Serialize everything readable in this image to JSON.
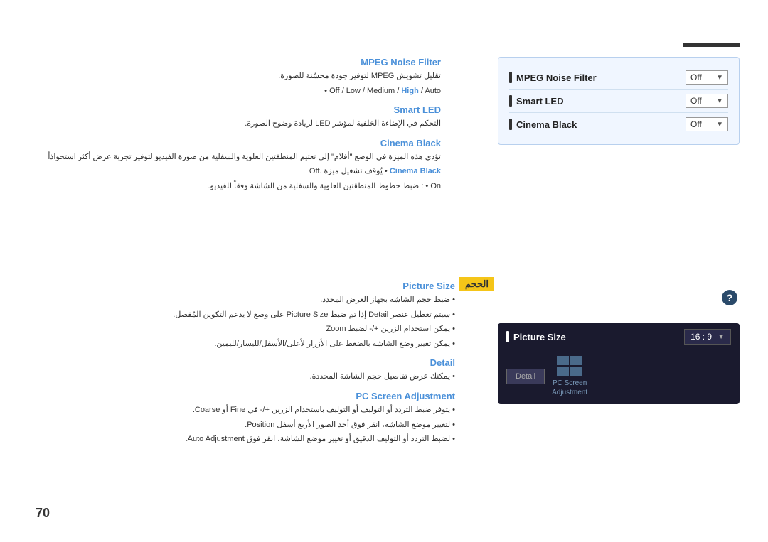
{
  "page": {
    "number": "70"
  },
  "top_section": {
    "mpeg_noise_filter": {
      "heading": "MPEG Noise Filter",
      "arabic_desc": "تقليل تشويش MPEG لتوفير جودة محسّنة للصورة.",
      "options_label": "Off / Low / Medium / High / Auto",
      "options_highlight": "High"
    },
    "smart_led": {
      "heading": "Smart LED",
      "arabic_desc": "التحكم في الإضاءة الخلفية لمؤشر LED لزيادة وضوح الصورة."
    },
    "cinema_black": {
      "heading": "Cinema Black",
      "arabic_intro": "تؤدي هذه الميزة في الوضع \"أفلام\" إلى تعتيم المنطقتين العلوية والسفلية من صورة الفيديو لتوفير تجربة عرض أكثر استحواذاً",
      "off_desc": "Off • يُوقف تشغيل ميزة Cinema Black.",
      "on_desc": "On : ضبط خطوط المنطقتين العلوية والسفلية من الشاشة وفقاً للفيديو."
    }
  },
  "control_panel": {
    "items": [
      {
        "label": "MPEG Noise Filter",
        "value": "Off",
        "bar": true
      },
      {
        "label": "Smart LED",
        "value": "Off",
        "bar": true
      },
      {
        "label": "Cinema Black",
        "value": "Off",
        "bar": true
      }
    ]
  },
  "bottom_section": {
    "yellow_label": "الحجم",
    "picture_size": {
      "heading": "Picture Size",
      "desc1": "• ضبط حجم الشاشة بجهاز العرض المحدد.",
      "desc2": "• سيتم تعطيل عنصر Detail إذا تم ضبط Picture Size على وضع لا يدعم التكوين المُفصل.",
      "desc3": "• يمكن استخدام الزرين +/- لضبط Zoom",
      "desc4": "• يمكن تغيير وضع الشاشة بالضغط على الأزرار لأعلى/الأسفل/لليسار/لليمين."
    },
    "detail": {
      "heading": "Detail",
      "desc": "• يمكنك عرض تفاصيل حجم الشاشة المحددة."
    },
    "pc_screen": {
      "heading": "PC Screen Adjustment",
      "desc1": "• يتوفر ضبط التردد أو التوليف أو التوليف باستخدام الزرين +/- في Fine أو Coarse.",
      "desc2": "• لتغيير موضع الشاشة، انقر فوق أحد الصور الأربع أسفل Position.",
      "desc3": "• لضبط التردد أو التوليف الدقيق أو تغيير موضع الشاشة، انقر فوق Auto Adjustment."
    },
    "panel": {
      "label": "Picture Size",
      "value": "16 : 9",
      "detail_button": "Detail",
      "pc_screen_label": "PC Screen\nAdjustment"
    }
  }
}
